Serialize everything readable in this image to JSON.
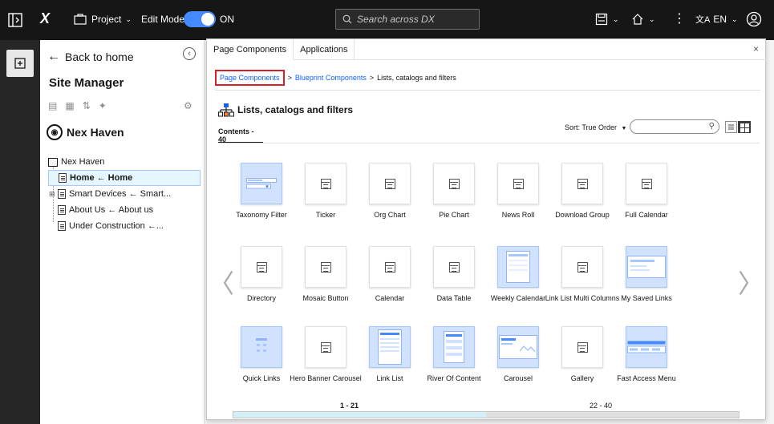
{
  "topbar": {
    "logo": "X",
    "project_label": "Project",
    "edit_mode_label": "Edit Mode:",
    "edit_mode_state": "ON",
    "search_placeholder": "Search across DX",
    "language": "EN"
  },
  "sitepanel": {
    "back_label": "Back to home",
    "title": "Site Manager",
    "site_name": "Nex Haven",
    "tree": [
      {
        "label": "Nex Haven",
        "indent": 0,
        "selected": false
      },
      {
        "label": "Home ← Home",
        "indent": 1,
        "selected": true
      },
      {
        "label": "Smart Devices ← Smart...",
        "indent": 1,
        "selected": false
      },
      {
        "label": "About Us ← About us",
        "indent": 1,
        "selected": false
      },
      {
        "label": "Under Construction ←...",
        "indent": 1,
        "selected": false
      }
    ]
  },
  "dialog": {
    "tabs": [
      "Page Components",
      "Applications"
    ],
    "close": "×",
    "breadcrumb": {
      "first": "Page Components",
      "second": "Blueprint Components",
      "current": "Lists, catalogs and filters",
      "separator": ">"
    },
    "section_title": "Lists, catalogs and filters",
    "contents_tab": "Contents - 40",
    "sort_label": "Sort: True Order",
    "filter_placeholder": "",
    "pager": {
      "left": "1 - 21",
      "right": "22 - 40"
    },
    "progress_fraction": 0.5,
    "components": [
      {
        "label": "Taxonomy Filter",
        "style": "taxonomy"
      },
      {
        "label": "Ticker",
        "style": "default"
      },
      {
        "label": "Org Chart",
        "style": "default"
      },
      {
        "label": "Pie Chart",
        "style": "default"
      },
      {
        "label": "News Roll",
        "style": "default"
      },
      {
        "label": "Download Group",
        "style": "default"
      },
      {
        "label": "Full Calendar",
        "style": "default"
      },
      {
        "label": "Directory",
        "style": "default"
      },
      {
        "label": "Mosaic Button",
        "style": "default"
      },
      {
        "label": "Calendar",
        "style": "default"
      },
      {
        "label": "Data Table",
        "style": "default"
      },
      {
        "label": "Weekly Calendar",
        "style": "weekly"
      },
      {
        "label": "Link List Multi Columns",
        "style": "default"
      },
      {
        "label": "My Saved Links",
        "style": "saved"
      },
      {
        "label": "Quick Links",
        "style": "quick"
      },
      {
        "label": "Hero Banner Carousel",
        "style": "default"
      },
      {
        "label": "Link List",
        "style": "linklist"
      },
      {
        "label": "River Of Content",
        "style": "river"
      },
      {
        "label": "Carousel",
        "style": "carousel"
      },
      {
        "label": "Gallery",
        "style": "default"
      },
      {
        "label": "Fast Access Menu",
        "style": "fastaccess"
      }
    ]
  },
  "colors": {
    "topbar": "#161616",
    "accent": "#0f62fe",
    "toggle": "#4589ff",
    "highlight_border": "#da1e28",
    "tile_highlight": "#d0e2ff"
  }
}
